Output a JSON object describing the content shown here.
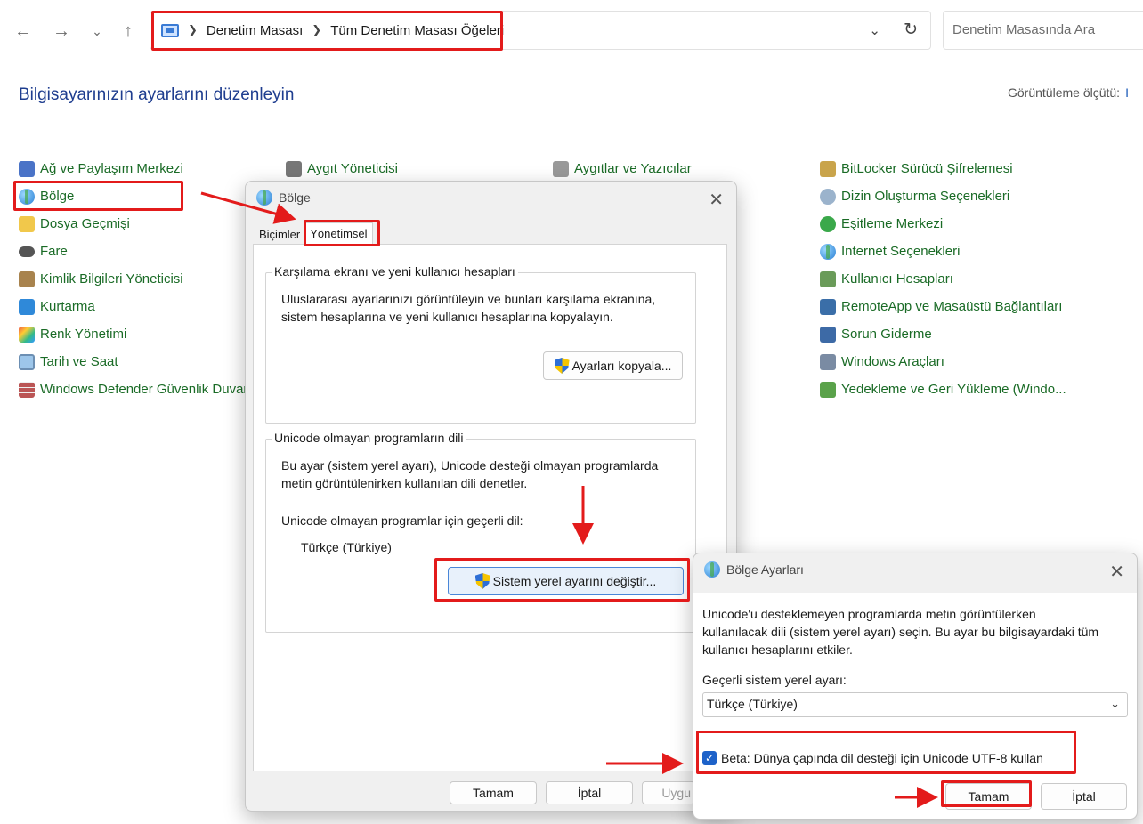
{
  "toolbar": {
    "back_icon": "arrow-left-icon",
    "forward_icon": "arrow-right-icon",
    "recent_icon": "chevron-down-icon",
    "up_icon": "arrow-up-icon",
    "breadcrumbs": [
      "Denetim Masası",
      "Tüm Denetim Masası Öğeleri"
    ],
    "search_placeholder": "Denetim Masasında Ara"
  },
  "header": {
    "title": "Bilgisayarınızın ayarlarını düzenleyin",
    "view_by_label": "Görüntüleme ölçütü:",
    "view_by_value": "I"
  },
  "items": {
    "col1": [
      "Ağ ve Paylaşım Merkezi",
      "Bölge",
      "Dosya Geçmişi",
      "Fare",
      "Kimlik Bilgileri Yöneticisi",
      "Kurtarma",
      "Renk Yönetimi",
      "Tarih ve Saat",
      "Windows Defender Güvenlik Duvar"
    ],
    "col2": [
      "Aygıt Yöneticisi"
    ],
    "col3": [
      "Aygıtlar ve Yazıcılar"
    ],
    "col4": [
      "BitLocker Sürücü Şifrelemesi",
      "Dizin Oluşturma Seçenekleri",
      "Eşitleme Merkezi",
      "Internet Seçenekleri",
      "Kullanıcı Hesapları",
      "RemoteApp ve Masaüstü Bağlantıları",
      "Sorun Giderme",
      "Windows Araçları",
      "Yedekleme ve Geri Yükleme (Windo..."
    ]
  },
  "bolge_dialog": {
    "title": "Bölge",
    "tabs": [
      "Biçimler",
      "Yönetimsel"
    ],
    "welcome_group": {
      "legend": "Karşılama ekranı ve yeni kullanıcı hesapları",
      "text_line1": "Uluslararası ayarlarınızı görüntüleyin ve bunları karşılama ekranına,",
      "text_line2": "sistem hesaplarına ve yeni kullanıcı hesaplarına kopyalayın.",
      "button": "Ayarları kopyala..."
    },
    "unicode_group": {
      "legend": "Unicode olmayan programların dili",
      "text_line1": "Bu ayar (sistem yerel ayarı), Unicode desteği olmayan programlarda",
      "text_line2": "metin görüntülenirken kullanılan dili denetler.",
      "current_label": "Unicode olmayan programlar için geçerli dil:",
      "current_value": "Türkçe (Türkiye)",
      "button": "Sistem yerel ayarını değiştir..."
    },
    "ok": "Tamam",
    "cancel": "İptal",
    "apply": "Uygu"
  },
  "ayar_dialog": {
    "title": "Bölge Ayarları",
    "description_line1": "Unicode'u desteklemeyen programlarda metin görüntülerken",
    "description_line2": "kullanılacak dili (sistem yerel ayarı) seçin. Bu ayar bu bilgisayardaki tüm",
    "description_line3": "kullanıcı hesaplarını etkiler.",
    "locale_label": "Geçerli sistem yerel ayarı:",
    "locale_value": "Türkçe (Türkiye)",
    "beta_label": "Beta: Dünya çapında dil desteği için Unicode UTF-8 kullan",
    "beta_checked": true,
    "ok": "Tamam",
    "cancel": "İptal"
  },
  "annotation_color": "#e31b1b"
}
